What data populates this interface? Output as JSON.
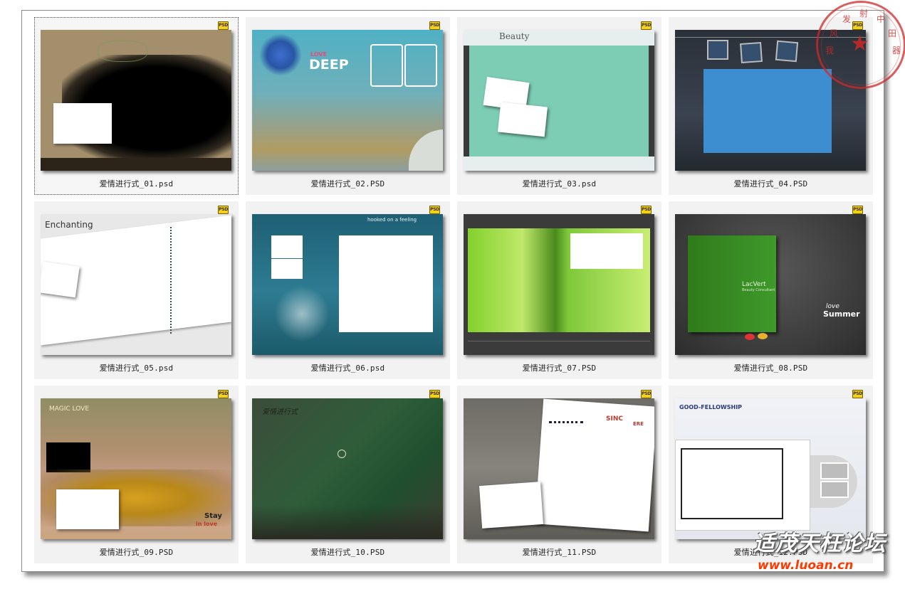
{
  "files": [
    {
      "name": "爱情进行式_01.psd",
      "type_badge": "PSD",
      "selected": true
    },
    {
      "name": "爱情进行式_02.PSD",
      "type_badge": "PSD",
      "thumb_text": [
        "LOVE",
        "DEEP"
      ]
    },
    {
      "name": "爱情进行式_03.psd",
      "type_badge": "PSD",
      "thumb_text": [
        "Beauty"
      ]
    },
    {
      "name": "爱情进行式_04.PSD",
      "type_badge": "PSD"
    },
    {
      "name": "爱情进行式_05.psd",
      "type_badge": "PSD",
      "thumb_text": [
        "Enchanting"
      ]
    },
    {
      "name": "爱情进行式_06.psd",
      "type_badge": "PSD",
      "thumb_text": [
        "hooked on a feeling"
      ]
    },
    {
      "name": "爱情进行式_07.PSD",
      "type_badge": "PSD"
    },
    {
      "name": "爱情进行式_08.PSD",
      "type_badge": "PSD",
      "thumb_text": [
        "LacVert",
        "Beauty Consultant",
        "love",
        "Summer"
      ]
    },
    {
      "name": "爱情进行式_09.PSD",
      "type_badge": "PSD",
      "thumb_text": [
        "MAGIC LOVE",
        "Stay",
        "in love"
      ]
    },
    {
      "name": "爱情进行式_10.PSD",
      "type_badge": "PSD",
      "thumb_text": [
        "爱情进行式"
      ]
    },
    {
      "name": "爱情进行式_11.PSD",
      "type_badge": "PSD",
      "thumb_text": [
        "SINC",
        "ERE"
      ]
    },
    {
      "name": "爱情进行式_12.PSD",
      "type_badge": "PSD",
      "thumb_text": [
        "GOOD-FELLOWSHIP"
      ]
    }
  ],
  "stamp": {
    "chars": [
      "我",
      "风",
      "发",
      "射",
      "中",
      "田",
      "器"
    ],
    "symbol": "★"
  },
  "watermark": {
    "title": "适茂天枉论坛",
    "url": "www.luoan.cn"
  },
  "colors": {
    "selection": "#444444",
    "badge": "#f2d21a",
    "stamp": "#cd2828",
    "watermark_url": "#ff3a00"
  }
}
